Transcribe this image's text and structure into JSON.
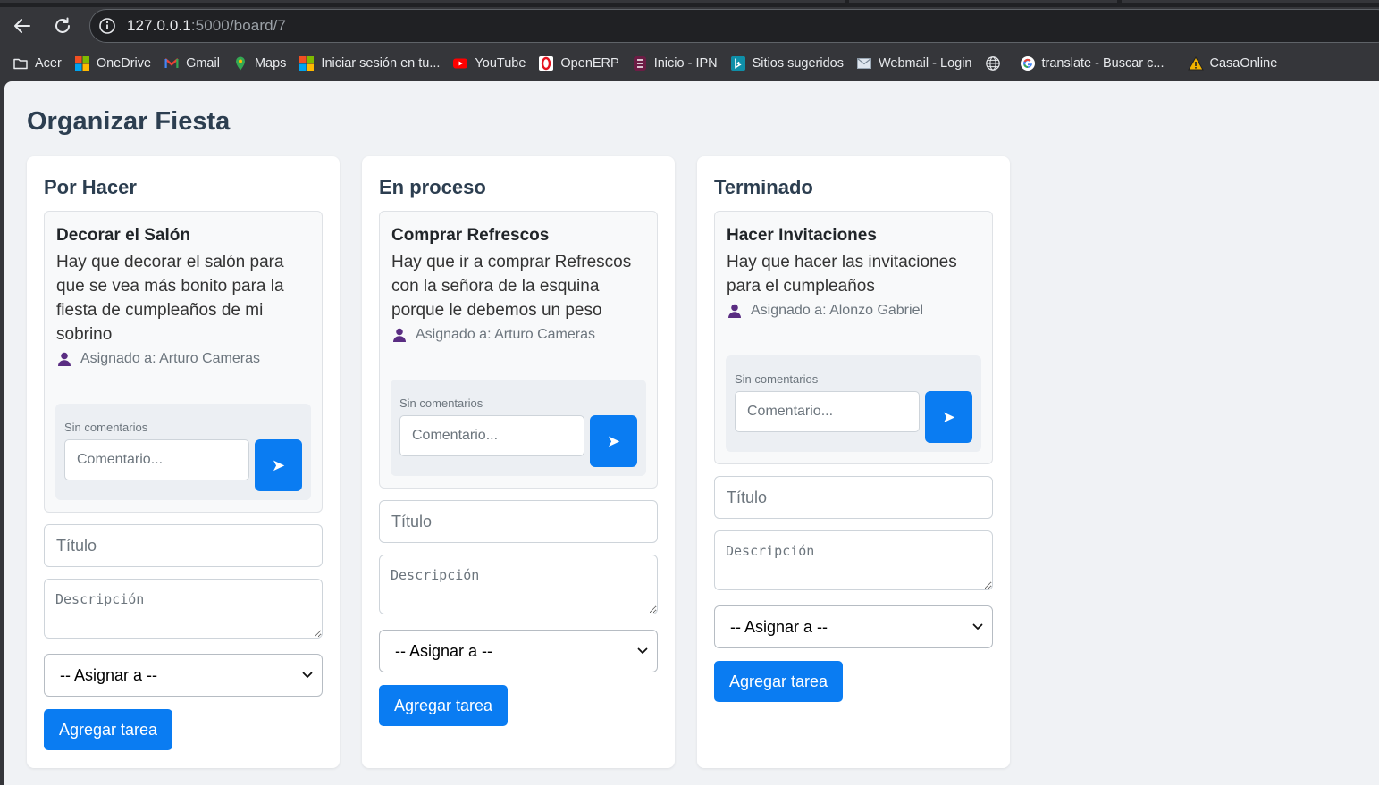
{
  "browser": {
    "url_host": "127.0.0.1",
    "url_rest": ":5000/board/7",
    "bookmarks": [
      {
        "label": "Acer",
        "icon": "folder-icon"
      },
      {
        "label": "OneDrive",
        "icon": "microsoft-icon"
      },
      {
        "label": "Gmail",
        "icon": "gmail-icon"
      },
      {
        "label": "Maps",
        "icon": "maps-icon"
      },
      {
        "label": "Iniciar sesión en tu...",
        "icon": "microsoft-icon"
      },
      {
        "label": "YouTube",
        "icon": "youtube-icon"
      },
      {
        "label": "OpenERP",
        "icon": "opera-icon"
      },
      {
        "label": "Inicio - IPN",
        "icon": "ipn-icon"
      },
      {
        "label": "Sitios sugeridos",
        "icon": "bing-icon"
      },
      {
        "label": "Webmail - Login",
        "icon": "mail-icon"
      },
      {
        "label": "",
        "icon": "globe-icon"
      },
      {
        "label": "translate - Buscar c...",
        "icon": "google-icon"
      },
      {
        "label": "CasaOnline",
        "icon": "warning-icon"
      }
    ]
  },
  "board": {
    "title": "Organizar Fiesta"
  },
  "form": {
    "title_placeholder": "Título",
    "desc_placeholder": "Descripción",
    "assign_default": "-- Asignar a --",
    "add_label": "Agregar tarea",
    "comment_placeholder": "Comentario...",
    "no_comments": "Sin comentarios",
    "send_glyph": "➤"
  },
  "columns": [
    {
      "title": "Por Hacer",
      "card": {
        "title": "Decorar el Salón",
        "description": "Hay que decorar el salón para que se vea más bonito para la fiesta de cumpleaños de mi sobrino",
        "assigned": "Asignado a: Arturo Cameras"
      }
    },
    {
      "title": "En proceso",
      "card": {
        "title": "Comprar Refrescos",
        "description": "Hay que ir a comprar Refrescos con la señora de la esquina porque le debemos un peso",
        "assigned": "Asignado a: Arturo Cameras"
      }
    },
    {
      "title": "Terminado",
      "card": {
        "title": "Hacer Invitaciones",
        "description": "Hay que hacer las invitaciones para el cumpleaños",
        "assigned": "Asignado a: Alonzo Gabriel"
      }
    }
  ],
  "colors": {
    "accent": "#0a7cf2",
    "heading": "#2c3e50",
    "page_bg": "#f0f2f5"
  }
}
